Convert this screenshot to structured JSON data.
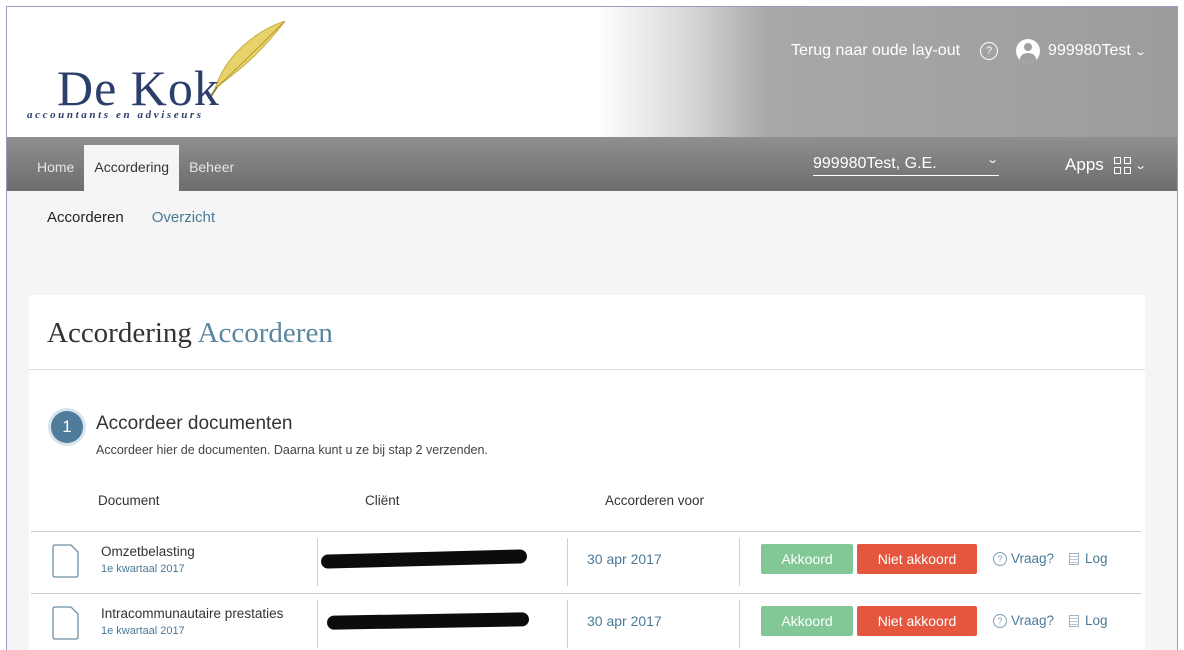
{
  "header": {
    "logo_brand": "De Kok",
    "logo_tagline": "accountants en adviseurs",
    "old_layout_link": "Terug naar oude lay-out",
    "help_symbol": "?",
    "user_name": "999980Test",
    "chevron": "⌄"
  },
  "nav": {
    "tabs": [
      {
        "label": "Home",
        "active": false
      },
      {
        "label": "Accordering",
        "active": true
      },
      {
        "label": "Beheer",
        "active": false
      }
    ],
    "client_select_value": "999980Test, G.E.",
    "apps_label": "Apps"
  },
  "subnav": {
    "items": [
      "Accorderen",
      "Overzicht"
    ]
  },
  "card": {
    "title_part1": "Accordering",
    "title_part2": "Accorderen",
    "step_number": "1",
    "step_title": "Accordeer documenten",
    "step_description": "Accordeer hier de documenten. Daarna kunt u ze bij stap 2 verzenden.",
    "columns": [
      "Document",
      "Cliënt",
      "Accorderen voor"
    ]
  },
  "rows": [
    {
      "document": "Omzetbelasting",
      "period": "1e kwartaal 2017",
      "date": "30 apr 2017",
      "approve": "Akkoord",
      "reject": "Niet akkoord",
      "question": "Vraag?",
      "log": "Log"
    },
    {
      "document": "Intracommunautaire prestaties",
      "period": "1e kwartaal 2017",
      "date": "30 apr 2017",
      "approve": "Akkoord",
      "reject": "Niet akkoord",
      "question": "Vraag?",
      "log": "Log"
    }
  ],
  "colors": {
    "accent": "#4e7c9a",
    "approve": "#82c896",
    "reject": "#e4563d",
    "brand": "#2c3e6a"
  }
}
